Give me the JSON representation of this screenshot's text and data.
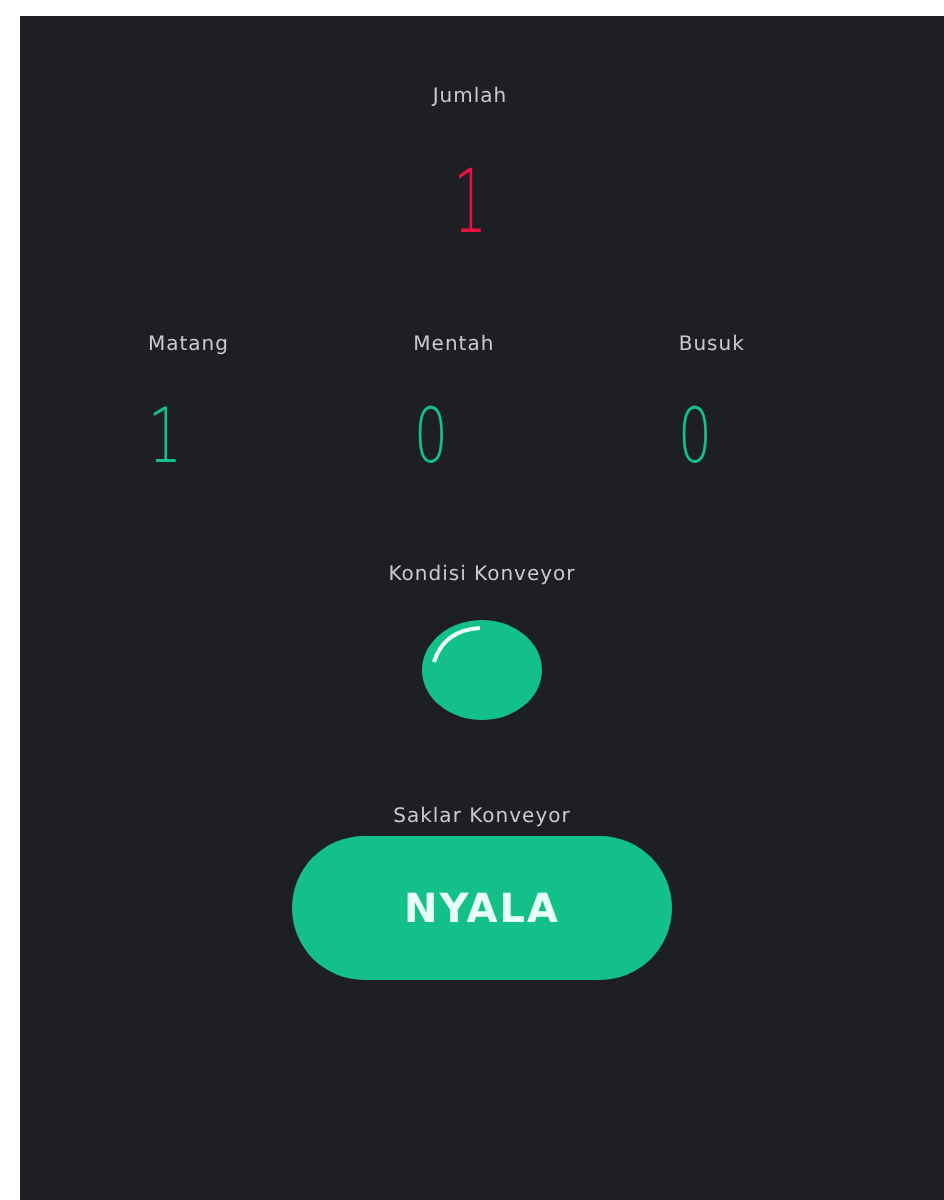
{
  "total": {
    "label": "Jumlah",
    "value": "1"
  },
  "counters": [
    {
      "label": "Matang",
      "value": "1"
    },
    {
      "label": "Mentah",
      "value": "0"
    },
    {
      "label": "Busuk",
      "value": "0"
    }
  ],
  "indicator": {
    "label": "Kondisi Konveyor",
    "on": true
  },
  "switch": {
    "label": "Saklar Konveyor",
    "text": "NYALA",
    "on": true
  }
}
